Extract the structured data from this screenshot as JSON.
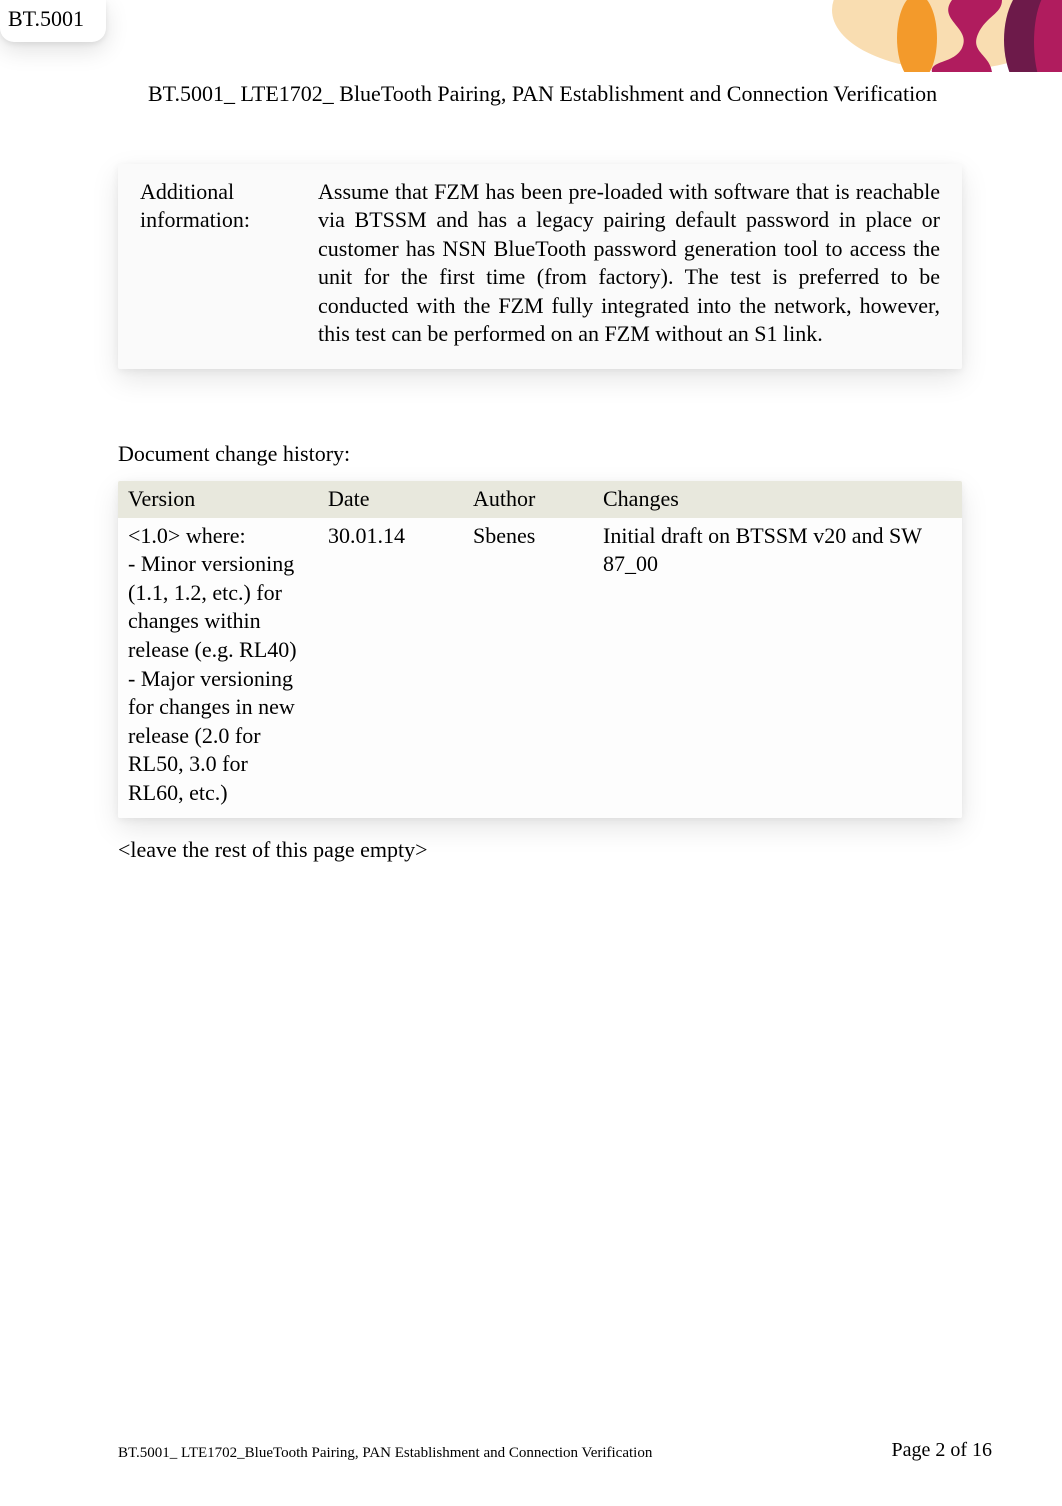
{
  "tab": {
    "label": "BT.5001"
  },
  "logo": {
    "colors": {
      "orange": "#f39a2b",
      "magenta": "#b01c5e",
      "deep": "#6d1a4a"
    }
  },
  "title": {
    "line": "BT.5001_ LTE1702_  BlueTooth Pairing, PAN Establishment and Connection Verification"
  },
  "info": {
    "label": "Additional information:",
    "text": "Assume that FZM has been pre-loaded with software that is reachable via BTSSM and has a legacy pairing default password in place or customer has NSN BlueTooth password generation tool to access the unit for the first time (from factory). The test is preferred to be conducted with the FZM fully integrated into the network, however, this test can be performed on an FZM without an S1 link."
  },
  "history": {
    "heading": "Document change history:",
    "headers": {
      "version": "Version",
      "date": "Date",
      "author": "Author",
      "changes": "Changes"
    },
    "rows": [
      {
        "version": "<1.0> where:\n- Minor versioning (1.1, 1.2, etc.) for changes within release (e.g. RL40)\n- Major versioning for changes in new release (2.0 for RL50, 3.0 for RL60, etc.)",
        "date": "30.01.14",
        "author": "Sbenes",
        "changes": "Initial draft on BTSSM v20 and SW 87_00"
      }
    ]
  },
  "placeholder_note": "<leave the rest of this page empty>",
  "footer": {
    "left": "BT.5001_  LTE1702_BlueTooth Pairing, PAN Establishment and Connection Verification",
    "right": "Page 2 of 16"
  }
}
